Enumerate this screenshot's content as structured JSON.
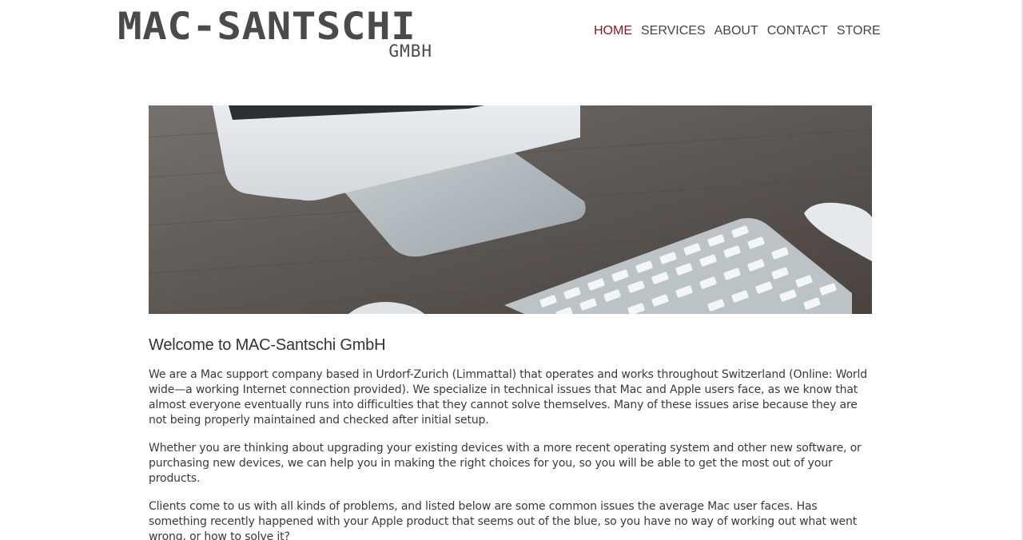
{
  "header": {
    "logo_main": "MAC-SANTSCHI",
    "logo_sub": "GMBH",
    "nav": [
      {
        "label": "HOME",
        "active": true
      },
      {
        "label": "SERVICES",
        "active": false
      },
      {
        "label": "ABOUT",
        "active": false
      },
      {
        "label": "CONTACT",
        "active": false
      },
      {
        "label": "STORE",
        "active": false
      }
    ],
    "active_color": "#8b1a1a"
  },
  "hero": {
    "icon": "desk-with-imac-and-keyboard-photo"
  },
  "main": {
    "title": "Welcome to MAC-Santschi GmbH",
    "paragraphs": [
      "We are a Mac support company based in Urdorf-Zurich (Limmattal) that operates and works throughout Switzerland (Online: World wide—a working Internet connection provided). We specialize in technical issues that Mac and Apple users face, as we know that almost everyone eventually runs into difficulties that they cannot solve themselves. Many of these issues arise because they are not being properly maintained and checked after initial setup.",
      "Whether you are thinking about upgrading your existing devices with a more recent operating system and other new software, or purchasing new devices, we can help you in making the right choices for you, so you will be able to get the most out of your products.",
      "Clients come to us with all kinds of problems, and listed below are some common issues the average Mac user faces. Has something recently happened with your Apple product that seems out of the blue, so you have no way of working out what went wrong, or how to solve it?"
    ]
  }
}
